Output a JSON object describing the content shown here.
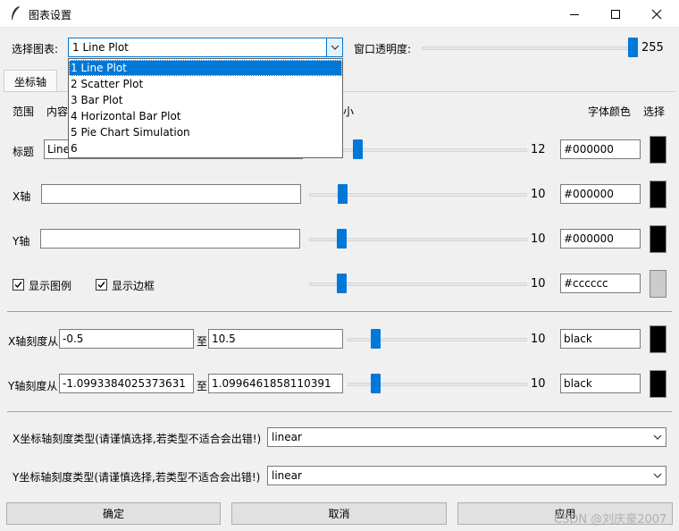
{
  "window": {
    "title": "图表设置"
  },
  "top": {
    "select_label": "选择图表:",
    "selected_chart": "1  Line Plot",
    "opacity_label": "窗口透明度:",
    "opacity_value": "255"
  },
  "dropdown": {
    "items": [
      "1  Line Plot",
      "2  Scatter Plot",
      "3  Bar Plot",
      "4  Horizontal Bar Plot",
      "5  Pie Chart Simulation",
      "6"
    ]
  },
  "tabs": [
    "坐标轴"
  ],
  "headers": {
    "range": "范围",
    "content": "内容",
    "size_partial": "小",
    "font_color": "字体颜色",
    "choose": "选择"
  },
  "rows": {
    "title": {
      "label": "标题",
      "value": "Line",
      "size": "12",
      "color": "#000000",
      "swatch": "#000000"
    },
    "xaxis": {
      "label": "X轴",
      "value": "",
      "size": "10",
      "color": "#000000",
      "swatch": "#000000"
    },
    "yaxis": {
      "label": "Y轴",
      "value": "",
      "size": "10",
      "color": "#000000",
      "swatch": "#000000"
    },
    "legend": {
      "show_legend": "显示图例",
      "show_border": "显示边框",
      "size": "10",
      "color": "#cccccc",
      "swatch": "#cccccc"
    }
  },
  "ticks": {
    "x": {
      "label": "X轴刻度从",
      "from": "-0.5",
      "to_label": "至",
      "to": "10.5",
      "size": "10",
      "color": "black",
      "swatch": "#000000"
    },
    "y": {
      "label": "Y轴刻度从",
      "from": "-1.0993384025373631",
      "to_label": "至",
      "to": "1.0996461858110391",
      "size": "10",
      "color": "black",
      "swatch": "#000000"
    }
  },
  "scale": {
    "x_label": "X坐标轴刻度类型(请谨慎选择,若类型不适合会出错!)",
    "x_value": "linear",
    "y_label": "Y坐标轴刻度类型(请谨慎选择,若类型不适合会出错!)",
    "y_value": "linear"
  },
  "buttons": {
    "ok": "确定",
    "cancel": "取消",
    "apply": "应用"
  },
  "watermark": "CSDN @刘庆豪2007"
}
